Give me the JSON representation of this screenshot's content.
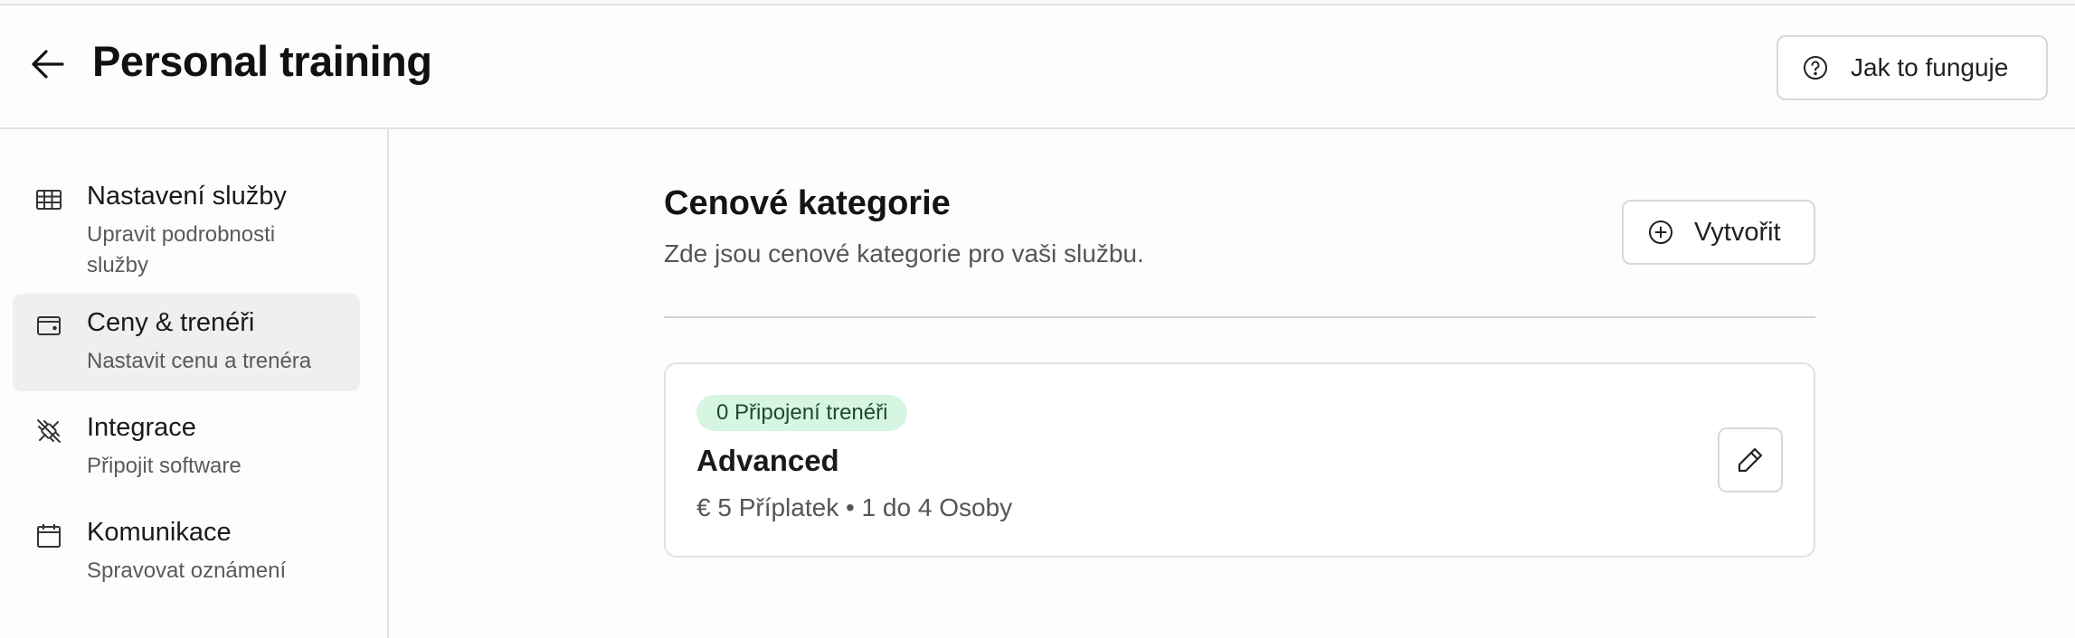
{
  "header": {
    "title": "Personal training",
    "help_label": "Jak to funguje"
  },
  "sidebar": {
    "items": [
      {
        "title": "Nastavení služby",
        "subtitle": "Upravit podrobnosti služby",
        "icon": "table-icon",
        "active": false
      },
      {
        "title": "Ceny & trenéři",
        "subtitle": "Nastavit cenu a trenéra",
        "icon": "wallet-icon",
        "active": true
      },
      {
        "title": "Integrace",
        "subtitle": "Připojit software",
        "icon": "plug-icon",
        "active": false
      },
      {
        "title": "Komunikace",
        "subtitle": "Spravovat oznámení",
        "icon": "calendar-icon",
        "active": false
      }
    ]
  },
  "main": {
    "title": "Cenové kategorie",
    "subtitle": "Zde jsou cenové kategorie pro vaši službu.",
    "create_label": "Vytvořit",
    "categories": [
      {
        "badge": "0 Připojení trenéři",
        "name": "Advanced",
        "meta": "€ 5 Příplatek • 1 do 4 Osoby"
      }
    ]
  },
  "colors": {
    "badge_bg": "#d6f5e3",
    "badge_text": "#1e4a30",
    "active_item_bg": "#efefef"
  }
}
